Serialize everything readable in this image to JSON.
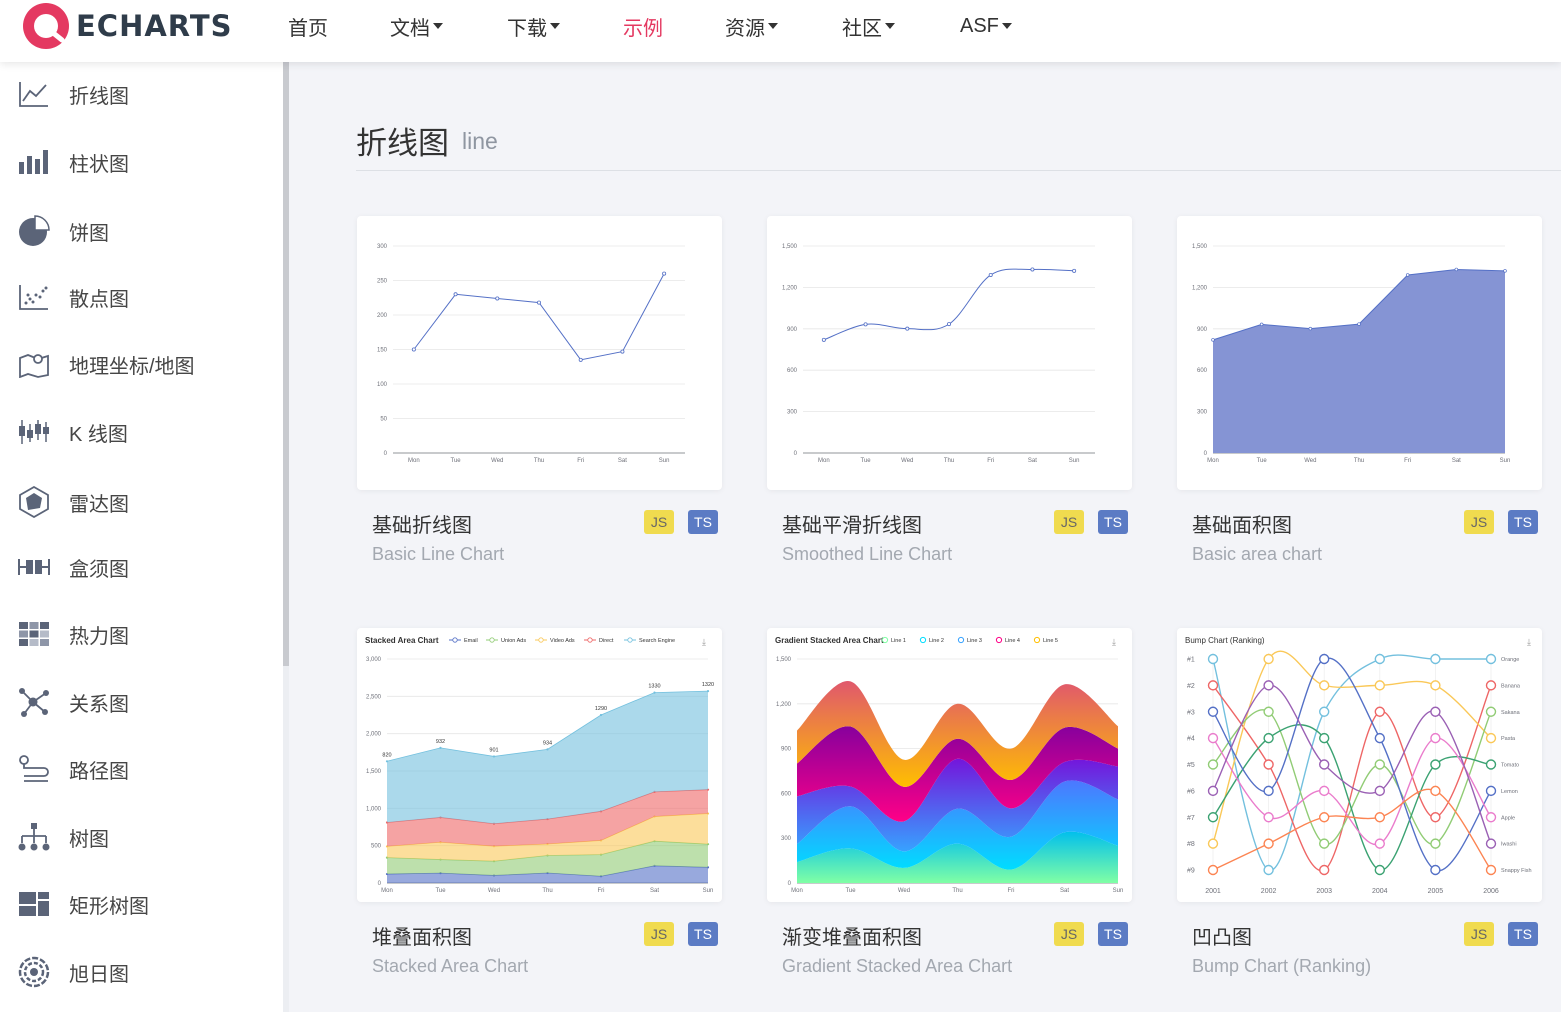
{
  "header": {
    "logo_text": "ECHARTS",
    "nav": [
      {
        "label": "首页",
        "dropdown": false,
        "active": false
      },
      {
        "label": "文档",
        "dropdown": true,
        "active": false
      },
      {
        "label": "下载",
        "dropdown": true,
        "active": false
      },
      {
        "label": "示例",
        "dropdown": false,
        "active": true
      },
      {
        "label": "资源",
        "dropdown": true,
        "active": false
      },
      {
        "label": "社区",
        "dropdown": true,
        "active": false
      },
      {
        "label": "ASF",
        "dropdown": true,
        "active": false
      }
    ]
  },
  "sidebar": {
    "items": [
      {
        "label": "折线图",
        "icon": "line-chart-icon"
      },
      {
        "label": "柱状图",
        "icon": "bar-chart-icon"
      },
      {
        "label": "饼图",
        "icon": "pie-chart-icon"
      },
      {
        "label": "散点图",
        "icon": "scatter-chart-icon"
      },
      {
        "label": "地理坐标/地图",
        "icon": "map-icon"
      },
      {
        "label": "K 线图",
        "icon": "candlestick-icon"
      },
      {
        "label": "雷达图",
        "icon": "radar-icon"
      },
      {
        "label": "盒须图",
        "icon": "boxplot-icon"
      },
      {
        "label": "热力图",
        "icon": "heatmap-icon"
      },
      {
        "label": "关系图",
        "icon": "graph-icon"
      },
      {
        "label": "路径图",
        "icon": "lines-icon"
      },
      {
        "label": "树图",
        "icon": "tree-icon"
      },
      {
        "label": "矩形树图",
        "icon": "treemap-icon"
      },
      {
        "label": "旭日图",
        "icon": "sunburst-icon"
      }
    ]
  },
  "section": {
    "title": "折线图",
    "subtitle": "line"
  },
  "accent_color": "#e43961",
  "theme_color": "#5470c6",
  "badges": {
    "js": "JS",
    "ts": "TS"
  },
  "cards": [
    {
      "title": "基础折线图",
      "subtitle": "Basic Line Chart"
    },
    {
      "title": "基础平滑折线图",
      "subtitle": "Smoothed Line Chart"
    },
    {
      "title": "基础面积图",
      "subtitle": "Basic area chart"
    },
    {
      "title": "堆叠面积图",
      "subtitle": "Stacked Area Chart"
    },
    {
      "title": "渐变堆叠面积图",
      "subtitle": "Gradient Stacked Area Chart"
    },
    {
      "title": "凹凸图",
      "subtitle": "Bump Chart (Ranking)"
    }
  ],
  "chart_data": [
    {
      "type": "line",
      "categories": [
        "Mon",
        "Tue",
        "Wed",
        "Thu",
        "Fri",
        "Sat",
        "Sun"
      ],
      "values": [
        150,
        230,
        224,
        218,
        135,
        147,
        260
      ],
      "ylim": [
        0,
        300
      ],
      "yticks": [
        "0",
        "50",
        "100",
        "150",
        "200",
        "250",
        "300"
      ]
    },
    {
      "type": "line",
      "smooth": true,
      "categories": [
        "Mon",
        "Tue",
        "Wed",
        "Thu",
        "Fri",
        "Sat",
        "Sun"
      ],
      "values": [
        820,
        932,
        901,
        934,
        1290,
        1330,
        1320
      ],
      "ylim": [
        0,
        1500
      ],
      "yticks": [
        "0",
        "300",
        "600",
        "900",
        "1,200",
        "1,500"
      ]
    },
    {
      "type": "area",
      "categories": [
        "Mon",
        "Tue",
        "Wed",
        "Thu",
        "Fri",
        "Sat",
        "Sun"
      ],
      "values": [
        820,
        932,
        901,
        934,
        1290,
        1330,
        1320
      ],
      "ylim": [
        0,
        1500
      ],
      "yticks": [
        "0",
        "300",
        "600",
        "900",
        "1,200",
        "1,500"
      ]
    },
    {
      "type": "area",
      "stacked": true,
      "title": "Stacked Area Chart",
      "categories": [
        "Mon",
        "Tue",
        "Wed",
        "Thu",
        "Fri",
        "Sat",
        "Sun"
      ],
      "ylim": [
        0,
        3000
      ],
      "yticks": [
        "0",
        "500",
        "1,000",
        "1,500",
        "2,000",
        "2,500",
        "3,000"
      ],
      "legend": [
        "Email",
        "Union Ads",
        "Video Ads",
        "Direct",
        "Search Engine"
      ],
      "series": [
        {
          "name": "Email",
          "values": [
            120,
            132,
            101,
            134,
            90,
            230,
            210
          ],
          "color": "#5470c6"
        },
        {
          "name": "Union Ads",
          "values": [
            220,
            182,
            191,
            234,
            290,
            330,
            310
          ],
          "color": "#91cc75"
        },
        {
          "name": "Video Ads",
          "values": [
            150,
            232,
            201,
            154,
            190,
            330,
            410
          ],
          "color": "#fac858"
        },
        {
          "name": "Direct",
          "values": [
            320,
            332,
            301,
            334,
            390,
            330,
            320
          ],
          "color": "#ee6666"
        },
        {
          "name": "Search Engine",
          "values": [
            820,
            932,
            901,
            934,
            1290,
            1330,
            1320
          ],
          "color": "#73c0de"
        }
      ],
      "labels": [
        "820",
        "932",
        "901",
        "934",
        "1290",
        "1330",
        "1320"
      ]
    },
    {
      "type": "area",
      "stacked": true,
      "smooth": true,
      "title": "Gradient Stacked Area Chart",
      "categories": [
        "Mon",
        "Tue",
        "Wed",
        "Thu",
        "Fri",
        "Sat",
        "Sun"
      ],
      "ylim": [
        0,
        1500
      ],
      "yticks": [
        "0",
        "300",
        "600",
        "900",
        "1,200",
        "1,500"
      ],
      "legend": [
        "Line 1",
        "Line 2",
        "Line 3",
        "Line 4",
        "Line 5"
      ],
      "series": [
        {
          "name": "Line 1",
          "values": [
            140,
            232,
            101,
            264,
            90,
            340,
            250
          ],
          "color": "#80ffa5"
        },
        {
          "name": "Line 2",
          "values": [
            120,
            282,
            111,
            234,
            220,
            340,
            310
          ],
          "color": "#00ddff"
        },
        {
          "name": "Line 3",
          "values": [
            320,
            132,
            201,
            334,
            190,
            130,
            220
          ],
          "color": "#37a2ff"
        },
        {
          "name": "Line 4",
          "values": [
            220,
            402,
            231,
            134,
            190,
            230,
            120
          ],
          "color": "#ff0087"
        },
        {
          "name": "Line 5",
          "values": [
            220,
            302,
            181,
            234,
            210,
            290,
            150
          ],
          "color": "#ffbf00"
        }
      ]
    },
    {
      "type": "line",
      "title": "Bump Chart (Ranking)",
      "x": [
        "2001",
        "2002",
        "2003",
        "2004",
        "2005",
        "2006"
      ],
      "yticks": [
        "#1",
        "#2",
        "#3",
        "#4",
        "#5",
        "#6",
        "#7",
        "#8",
        "#9"
      ],
      "series": [
        {
          "name": "Orange",
          "values": [
            1,
            9,
            3,
            1,
            1,
            1
          ],
          "color": "#73c0de"
        },
        {
          "name": "Banana",
          "values": [
            2,
            5,
            9,
            3,
            7,
            2
          ],
          "color": "#ee6666"
        },
        {
          "name": "Pasta",
          "values": [
            8,
            1,
            2,
            2,
            2,
            4
          ],
          "color": "#fac858"
        },
        {
          "name": "Sakana",
          "values": [
            5,
            3,
            8,
            5,
            8,
            3
          ],
          "color": "#91cc75"
        },
        {
          "name": "Tomato",
          "values": [
            7,
            4,
            4,
            9,
            5,
            5
          ],
          "color": "#3ba272"
        },
        {
          "name": "Lemon",
          "values": [
            3,
            6,
            1,
            4,
            9,
            6
          ],
          "color": "#5470c6"
        },
        {
          "name": "Apple",
          "values": [
            4,
            7,
            6,
            8,
            4,
            7
          ],
          "color": "#ea7ccc"
        },
        {
          "name": "Iwashi",
          "values": [
            6,
            2,
            5,
            6,
            3,
            8
          ],
          "color": "#9a60b4"
        },
        {
          "name": "Snappy Fish",
          "values": [
            9,
            8,
            7,
            7,
            6,
            9
          ],
          "color": "#fc8452"
        }
      ]
    }
  ]
}
